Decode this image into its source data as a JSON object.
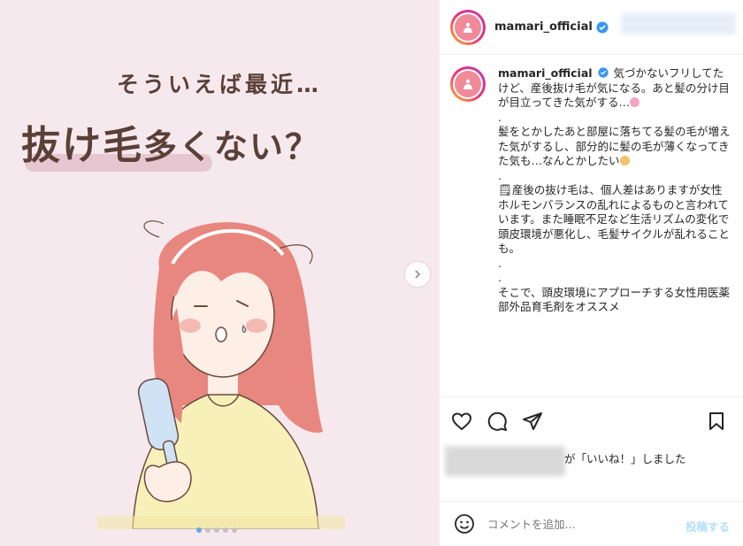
{
  "image": {
    "kicker": "そういえば最近…",
    "headline_big": "抜け毛",
    "headline_small": "多くない？",
    "carousel_dots": 5,
    "carousel_active": 0
  },
  "header": {
    "username": "mamari_official"
  },
  "caption": {
    "username": "mamari_official",
    "paragraphs": [
      "気づかないフリしてたけど、産後抜け毛が気になる。あと髪の分け目が目立ってきた気がする…",
      ".",
      "髪をとかしたあと部屋に落ちてる髪の毛が増えた気がするし、部分的に髪の毛が薄くなってきた気も…なんとかしたい",
      ".",
      "🗒産後の抜け毛は、個人差はありますが女性ホルモンバランスの乱れによるものと言われています。また睡眠不足など生活リズムの変化で頭皮環境が悪化し、毛髪サイクルが乱れることも。",
      ".",
      ".",
      "そこで、頭皮環境にアプローチする女性用医薬部外品育毛剤をオススメ"
    ]
  },
  "likes": {
    "text": "が「いいね！」しました"
  },
  "comment": {
    "placeholder": "コメントを追加...",
    "post_label": "投稿する"
  },
  "colors": {
    "image_bg": "#f6e9ee",
    "headline": "#5b4038",
    "hair": "#e8877f",
    "shirt": "#f7f1b9",
    "verified": "#3897f0",
    "post_button": "#b2dffc"
  }
}
